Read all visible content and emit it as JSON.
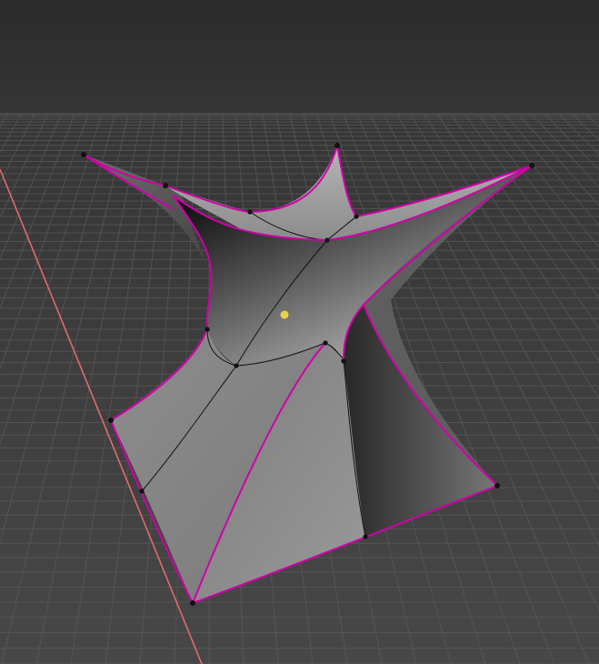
{
  "viewport": {
    "mode": "3d-viewport-edit-mode",
    "colors": {
      "background_top": "#2b2b2b",
      "background_bottom": "#474747",
      "grid_line": "#5a5a5a",
      "axis_x": "#e06b6b",
      "edge_selected": "#d000a8",
      "wire": "#111111",
      "vertex": "#111111",
      "pivot": "#e6d24a",
      "surface_light": "#9c9c9c",
      "surface_dark": "#2a2a2a"
    },
    "icons": {
      "vertex": "vertex-dot-icon",
      "pivot": "pivot-point-icon"
    }
  }
}
